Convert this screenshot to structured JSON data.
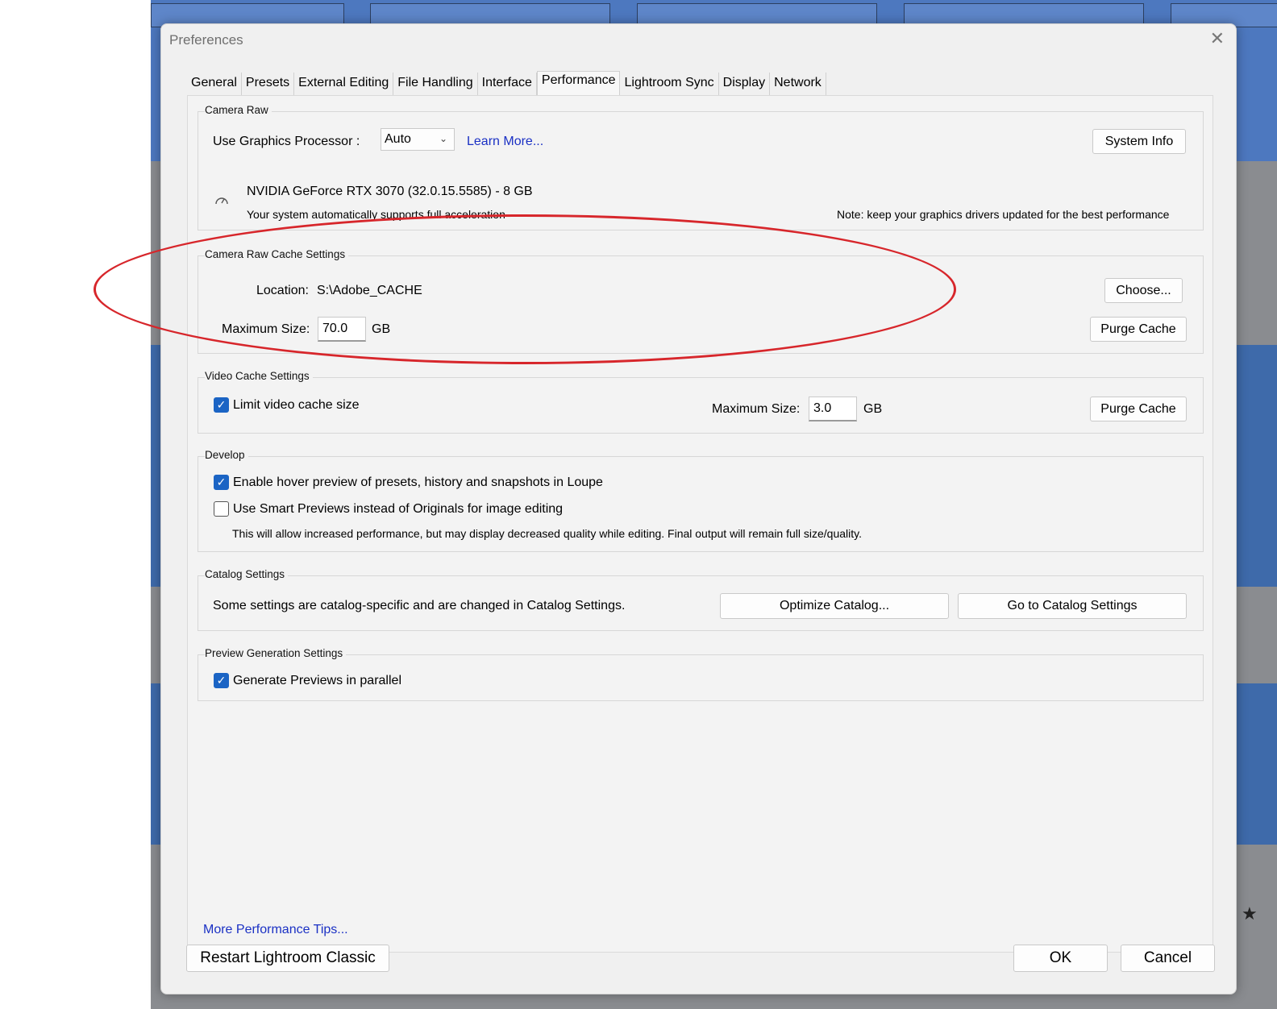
{
  "dialog": {
    "title": "Preferences",
    "close_glyph": "✕"
  },
  "tabs": [
    {
      "label": "General",
      "active": false
    },
    {
      "label": "Presets",
      "active": false
    },
    {
      "label": "External Editing",
      "active": false
    },
    {
      "label": "File Handling",
      "active": false
    },
    {
      "label": "Interface",
      "active": false
    },
    {
      "label": "Performance",
      "active": true
    },
    {
      "label": "Lightroom Sync",
      "active": false
    },
    {
      "label": "Display",
      "active": false
    },
    {
      "label": "Network",
      "active": false
    }
  ],
  "camera_raw": {
    "group_label": "Camera Raw",
    "gpu_label": "Use Graphics Processor :",
    "gpu_value": "Auto",
    "learn_more": "Learn More...",
    "system_info": "System Info",
    "gpu_name": "NVIDIA GeForce RTX 3070 (32.0.15.5585) - 8 GB",
    "gpu_status": "Your system automatically supports full acceleration",
    "driver_note": "Note: keep your graphics drivers updated for the best performance",
    "gpu_icon": "gauge-icon"
  },
  "cache": {
    "group_label": "Camera Raw Cache Settings",
    "location_label": "Location:",
    "location_value": "S:\\Adobe_CACHE",
    "choose": "Choose...",
    "max_size_label": "Maximum Size:",
    "max_size_value": "70.0",
    "unit": "GB",
    "purge": "Purge Cache"
  },
  "video_cache": {
    "group_label": "Video Cache Settings",
    "limit_label": "Limit video cache size",
    "limit_checked": true,
    "max_size_label": "Maximum Size:",
    "max_size_value": "3.0",
    "unit": "GB",
    "purge": "Purge Cache"
  },
  "develop": {
    "group_label": "Develop",
    "hover_label": "Enable hover preview of presets, history and snapshots in Loupe",
    "hover_checked": true,
    "smart_label": "Use Smart Previews instead of Originals for image editing",
    "smart_checked": false,
    "smart_note": "This will allow increased performance, but may display decreased quality while editing. Final output will remain full size/quality."
  },
  "catalog": {
    "group_label": "Catalog Settings",
    "note": "Some settings are catalog-specific and are changed in Catalog Settings.",
    "optimize": "Optimize Catalog...",
    "goto": "Go to Catalog Settings"
  },
  "preview": {
    "group_label": "Preview Generation Settings",
    "parallel_label": "Generate Previews in parallel",
    "parallel_checked": true
  },
  "footer": {
    "tips_link": "More Performance Tips...",
    "restart": "Restart Lightroom Classic",
    "ok": "OK",
    "cancel": "Cancel"
  },
  "background": {
    "star_glyph": "★"
  },
  "colors": {
    "accent": "#1b64c4",
    "link": "#1a30c4",
    "annotation": "#d7262b"
  }
}
